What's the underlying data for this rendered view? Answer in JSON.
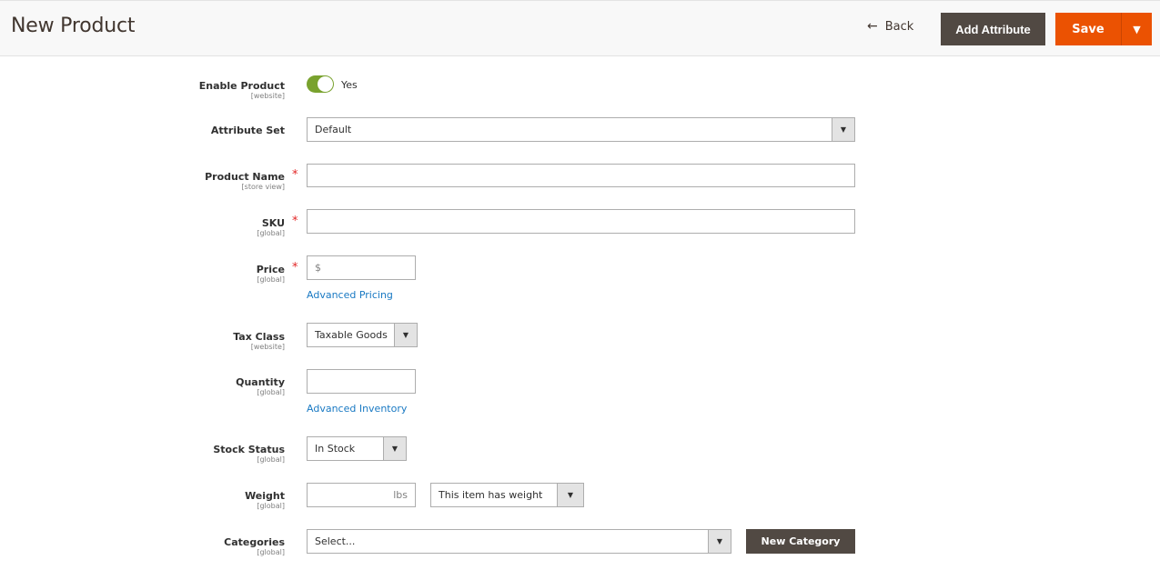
{
  "header": {
    "title": "New Product",
    "back_label": "Back",
    "back_icon": "arrow-left-icon",
    "add_attribute_label": "Add Attribute",
    "save_label": "Save",
    "save_menu_icon": "caret-down-icon"
  },
  "colors": {
    "primary": "#eb5202",
    "secondary": "#514943",
    "toggle_on": "#79a22e",
    "link": "#1979c3",
    "required": "#e22626"
  },
  "form": {
    "enable_product": {
      "label": "Enable Product",
      "scope": "[website]",
      "value_text": "Yes",
      "enabled": true
    },
    "attribute_set": {
      "label": "Attribute Set",
      "value": "Default"
    },
    "product_name": {
      "label": "Product Name",
      "scope": "[store view]",
      "required": "*",
      "value": ""
    },
    "sku": {
      "label": "SKU",
      "scope": "[global]",
      "required": "*",
      "value": ""
    },
    "price": {
      "label": "Price",
      "scope": "[global]",
      "required": "*",
      "prefix": "$",
      "value": "",
      "link": "Advanced Pricing"
    },
    "tax_class": {
      "label": "Tax Class",
      "scope": "[website]",
      "value": "Taxable Goods"
    },
    "quantity": {
      "label": "Quantity",
      "scope": "[global]",
      "value": "",
      "link": "Advanced Inventory"
    },
    "stock_status": {
      "label": "Stock Status",
      "scope": "[global]",
      "value": "In Stock"
    },
    "weight": {
      "label": "Weight",
      "scope": "[global]",
      "unit": "lbs",
      "value": "",
      "type_value": "This item has weight"
    },
    "categories": {
      "label": "Categories",
      "scope": "[global]",
      "placeholder": "Select...",
      "new_button": "New Category"
    }
  }
}
